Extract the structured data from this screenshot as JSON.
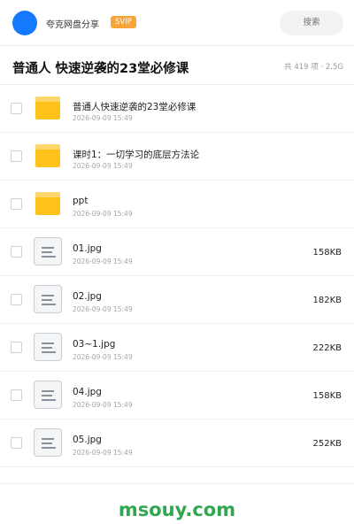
{
  "header": {
    "share_label": "夸克网盘分享",
    "vip_badge": "SVIP",
    "search_placeholder": "搜索",
    "avatar_color": "#1677ff",
    "vip_color": "#f7a538"
  },
  "folder": {
    "title": "普通人 快速逆袭的23堂必修课",
    "summary": "共 419 项 · 2.5G"
  },
  "items": [
    {
      "type": "folder",
      "name": "普通人快速逆袭的23堂必修课",
      "date": "2026-09-09 15:49",
      "size": ""
    },
    {
      "type": "folder",
      "name": "课时1：一切学习的底层方法论",
      "date": "2026-09-09 15:49",
      "size": ""
    },
    {
      "type": "folder",
      "name": "ppt",
      "date": "2026-09-09 15:49",
      "size": ""
    },
    {
      "type": "file",
      "name": "01.jpg",
      "date": "2026-09-09 15:49",
      "size": "158KB"
    },
    {
      "type": "file",
      "name": "02.jpg",
      "date": "2026-09-09 15:49",
      "size": "182KB"
    },
    {
      "type": "file",
      "name": "03~1.jpg",
      "date": "2026-09-09 15:49",
      "size": "222KB"
    },
    {
      "type": "file",
      "name": "04.jpg",
      "date": "2026-09-09 15:49",
      "size": "158KB"
    },
    {
      "type": "file",
      "name": "05.jpg",
      "date": "2026-09-09 15:49",
      "size": "252KB"
    }
  ],
  "icons": {
    "folder": "folder-icon",
    "file": "image-file-icon"
  },
  "watermark": "msouy.com"
}
